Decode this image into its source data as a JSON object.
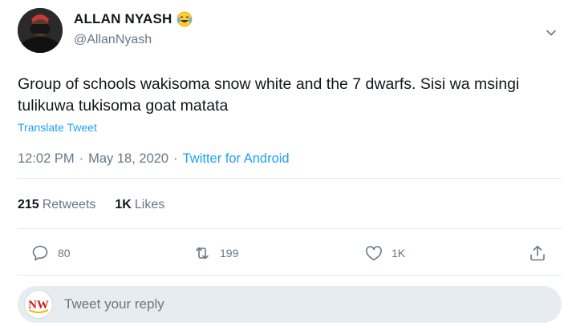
{
  "author": {
    "name": "ALLAN NYASH",
    "handle": "@AllanNyash"
  },
  "tweet": {
    "text": "Group of schools wakisoma snow white and the 7 dwarfs. Sisi wa msingi tulikuwa tukisoma goat matata",
    "translate_label": "Translate Tweet",
    "time": "12:02 PM",
    "date": "May 18, 2020",
    "source": "Twitter for Android"
  },
  "stats": {
    "retweets_count": "215",
    "retweets_label": "Retweets",
    "likes_count": "1K",
    "likes_label": "Likes"
  },
  "actions": {
    "reply_count": "80",
    "retweet_count": "199",
    "like_count": "1K"
  },
  "reply": {
    "placeholder": "Tweet your reply",
    "avatar_text": "NW"
  },
  "colors": {
    "accent": "#1da1f2",
    "secondary_text": "#657786",
    "divider": "#e1e8ed",
    "reply_bg": "#e6ecf0"
  },
  "icons": {
    "caret": "chevron-down-icon",
    "reply": "reply-icon",
    "retweet": "retweet-icon",
    "like": "heart-icon",
    "share": "share-icon",
    "emoji": "tears-of-joy-emoji"
  }
}
